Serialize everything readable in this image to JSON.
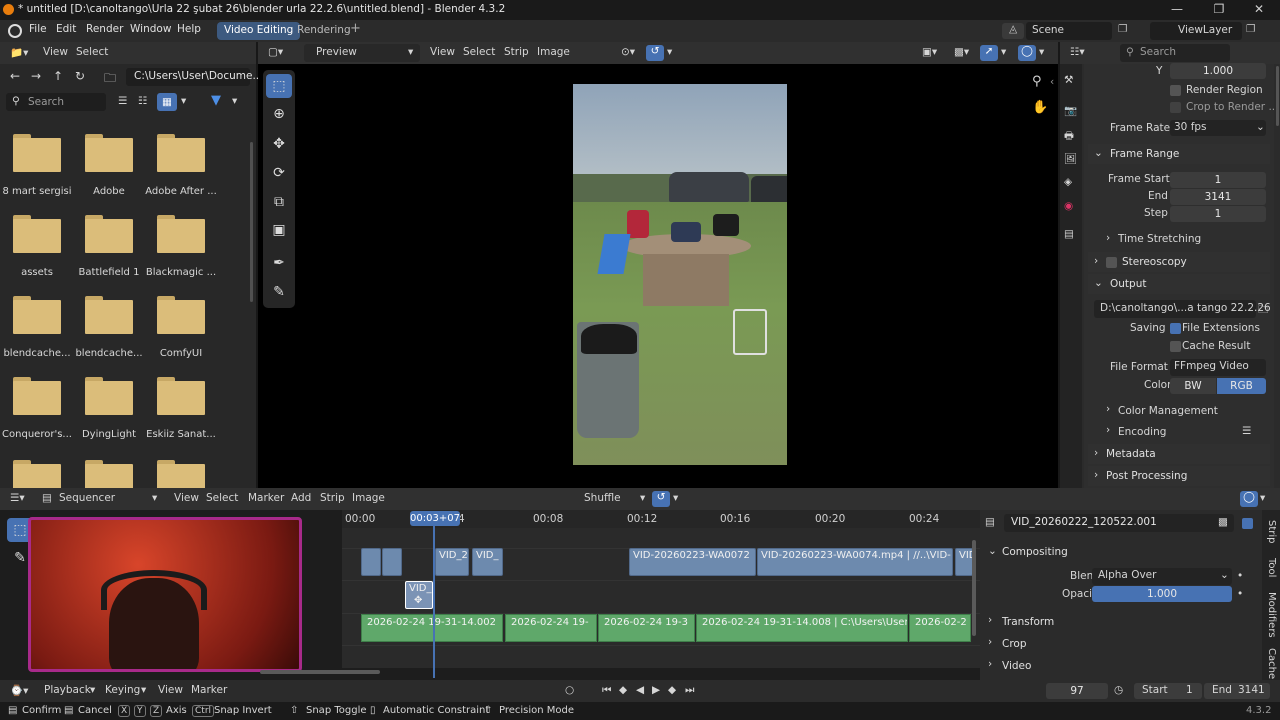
{
  "titlebar": {
    "title": "* untitled [D:\\canoltango\\Urla 22 şubat 26\\blender urla 22.2.6\\untitled.blend] - Blender 4.3.2"
  },
  "menu": [
    "File",
    "Edit",
    "Render",
    "Window",
    "Help"
  ],
  "workspaces": [
    {
      "label": "Video Editing",
      "active": true
    },
    {
      "label": "Rendering",
      "active": false
    }
  ],
  "scene": {
    "label": "Scene",
    "viewlayer": "ViewLayer"
  },
  "filebrowser": {
    "header": [
      "View",
      "Select"
    ],
    "path": "C:\\Users\\User\\Docume...",
    "search_placeholder": "Search",
    "folders": [
      "8 mart sergisi",
      "Adobe",
      "Adobe After ...",
      "assets",
      "Battlefield 1",
      "Blackmagic ...",
      "blendcache...",
      "blendcache...",
      "ComfyUI",
      "Conqueror's...",
      "DyingLight",
      "Eskiiz Sanat..."
    ]
  },
  "preview": {
    "mode": "Preview",
    "menus": [
      "View",
      "Select",
      "Strip",
      "Image"
    ]
  },
  "properties": {
    "search_placeholder": "Search",
    "y_label": "Y",
    "y_value": "1.000",
    "render_region": "Render Region",
    "crop_to_render": "Crop to Render ...",
    "frame_rate_label": "Frame Rate",
    "frame_rate": "30 fps",
    "frame_range": "Frame Range",
    "frame_start_label": "Frame Start",
    "frame_start": "1",
    "end_label": "End",
    "end": "3141",
    "step_label": "Step",
    "step": "1",
    "time_stretching": "Time Stretching",
    "stereoscopy": "Stereoscopy",
    "output": "Output",
    "output_path": "D:\\canoltango\\...a tango 22.2.26",
    "saving_label": "Saving",
    "file_extensions": "File Extensions",
    "cache_result": "Cache Result",
    "file_format_label": "File Format",
    "file_format": "FFmpeg Video",
    "color_label": "Color",
    "color_bw": "BW",
    "color_rgb": "RGB",
    "color_management": "Color Management",
    "encoding": "Encoding",
    "metadata": "Metadata",
    "post_processing": "Post Processing"
  },
  "sequencer": {
    "editor": "Sequencer",
    "menus": [
      "View",
      "Select",
      "Marker",
      "Add",
      "Strip",
      "Image"
    ],
    "snap": "Shuffle",
    "playhead_time": "00:03+07",
    "playhead_tail": "4",
    "ticks": [
      "00:00",
      "00:08",
      "00:12",
      "00:16",
      "00:20",
      "00:24"
    ],
    "blue_strips": [
      "VID_2",
      "VID_",
      "VID-20260223-WA0072",
      "VID-20260223-WA0074.mp4 | //..\\VID-",
      "VID"
    ],
    "selected_strip": "VID_",
    "green_strips": [
      "2026-02-24 19-31-14.002",
      "2026-02-24 19-",
      "2026-02-24 19-3",
      "2026-02-24 19-31-14.008 | C:\\Users\\User",
      "2026-02-2"
    ]
  },
  "strip_props": {
    "name": "VID_20260222_120522.001",
    "compositing": "Compositing",
    "blend_label": "Blend",
    "blend": "Alpha Over",
    "opacity_label": "Opacity",
    "opacity": "1.000",
    "transform": "Transform",
    "crop": "Crop",
    "video": "Video",
    "side_tabs": [
      "Strip",
      "Tool",
      "Modifiers",
      "Cache"
    ]
  },
  "timeline": {
    "menus": [
      "Playback",
      "Keying",
      "View",
      "Marker"
    ],
    "current_frame": "97",
    "start_label": "Start",
    "start": "1",
    "end_label": "End",
    "end": "3141"
  },
  "statusbar": {
    "items": [
      "Confirm",
      "Cancel",
      "Axis",
      "Snap Invert",
      "Snap Toggle",
      "Automatic Constraint",
      "Precision Mode"
    ],
    "keys": {
      "x": "X",
      "y": "Y",
      "z": "Z",
      "ctrl": "Ctrl"
    },
    "version": "4.3.2"
  },
  "colors": {
    "accent": "#4772b3",
    "active_tab": "#3d5a80",
    "strip_blue": "#6d8aae",
    "strip_green": "#5fa86a"
  }
}
